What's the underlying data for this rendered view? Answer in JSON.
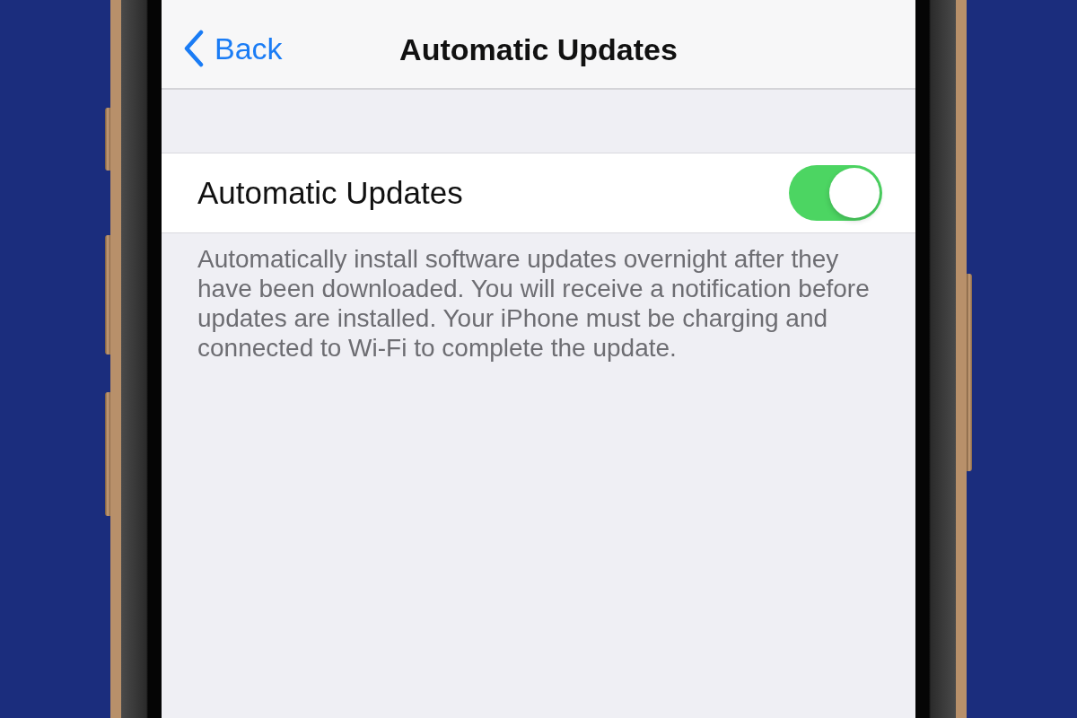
{
  "nav_bar": {
    "back_label": "Back",
    "title": "Automatic Updates"
  },
  "settings": [
    {
      "kind": "toggle",
      "label": "Automatic Updates",
      "on": true
    }
  ],
  "footer": "Automatically install software updates overnight after they have been downloaded. You will receive a notification before updates are installed. Your iPhone must be charging and connected to Wi-Fi to complete the update."
}
